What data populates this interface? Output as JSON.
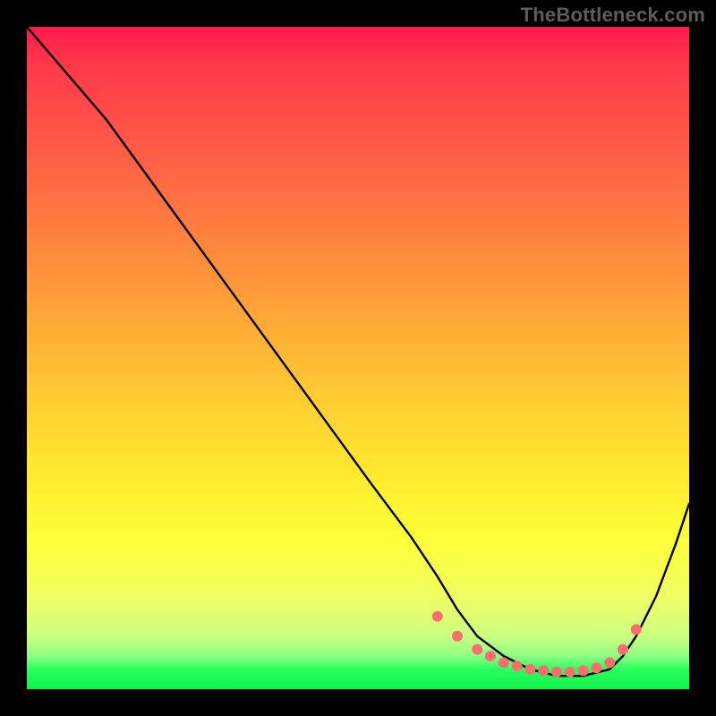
{
  "watermark": "TheBottleneck.com",
  "colors": {
    "curve": "#000000",
    "marker": "#ff6e6e",
    "frame": "#000000"
  },
  "chart_data": {
    "type": "line",
    "title": "",
    "xlabel": "",
    "ylabel": "",
    "xlim": [
      0,
      100
    ],
    "ylim": [
      0,
      100
    ],
    "note": "Axes unlabelled; x/y values are estimated percentages of plot width/height (origin bottom-left).",
    "series": [
      {
        "name": "curve",
        "x": [
          0,
          6,
          12,
          20,
          28,
          36,
          44,
          52,
          58,
          62,
          65,
          68,
          72,
          76,
          80,
          84,
          88,
          90,
          92,
          95,
          98,
          100
        ],
        "y": [
          100,
          93,
          86,
          75,
          64,
          53,
          42,
          31,
          23,
          17,
          12,
          8,
          5,
          3,
          2,
          2,
          3,
          5,
          8,
          14,
          22,
          28
        ]
      }
    ],
    "markers": {
      "name": "highlighted-points",
      "x": [
        62,
        65,
        68,
        70,
        72,
        74,
        76,
        78,
        80,
        82,
        84,
        86,
        88,
        90,
        92
      ],
      "y": [
        11,
        8,
        6,
        5,
        4,
        3.5,
        3,
        2.8,
        2.6,
        2.6,
        2.8,
        3.2,
        4,
        6,
        9
      ]
    },
    "gradient_bands": [
      {
        "pos": 0.0,
        "color": "#ff1a4c"
      },
      {
        "pos": 0.3,
        "color": "#ff7d3f"
      },
      {
        "pos": 0.55,
        "color": "#ffc933"
      },
      {
        "pos": 0.77,
        "color": "#fdff37"
      },
      {
        "pos": 0.95,
        "color": "#8dff85"
      },
      {
        "pos": 1.0,
        "color": "#0cf24a"
      }
    ]
  }
}
